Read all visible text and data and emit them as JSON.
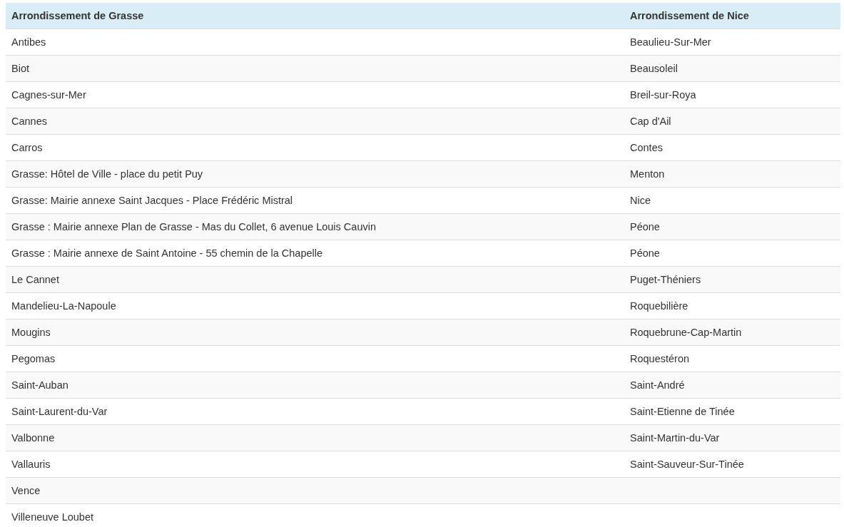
{
  "table": {
    "columns": [
      "Arrondissement de Grasse",
      "Arrondissement de Nice"
    ],
    "rows": [
      {
        "cells": [
          "Antibes",
          "Beaulieu-Sur-Mer"
        ]
      },
      {
        "cells": [
          "Biot",
          "Beausoleil"
        ]
      },
      {
        "cells": [
          "Cagnes-sur-Mer",
          "Breil-sur-Roya"
        ]
      },
      {
        "cells": [
          "Cannes",
          "Cap d'Ail"
        ]
      },
      {
        "cells": [
          "Carros",
          "Contes"
        ]
      },
      {
        "cells": [
          "Grasse: Hôtel de Ville - place du petit Puy",
          "Menton"
        ]
      },
      {
        "cells": [
          "Grasse: Mairie annexe Saint Jacques - Place Frédéric Mistral",
          "Nice"
        ]
      },
      {
        "cells": [
          "Grasse : Mairie annexe Plan de Grasse - Mas du Collet, 6 avenue Louis Cauvin",
          "Péone"
        ]
      },
      {
        "cells": [
          "Grasse : Mairie annexe de Saint Antoine - 55 chemin de la Chapelle",
          "Péone"
        ]
      },
      {
        "cells": [
          "Le Cannet",
          "Puget-Théniers"
        ]
      },
      {
        "cells": [
          "Mandelieu-La-Napoule",
          "Roquebilière"
        ]
      },
      {
        "cells": [
          "Mougins",
          "Roquebrune-Cap-Martin"
        ]
      },
      {
        "cells": [
          "Pegomas",
          "Roquestéron"
        ]
      },
      {
        "cells": [
          "Saint-Auban",
          "Saint-André"
        ]
      },
      {
        "cells": [
          "Saint-Laurent-du-Var",
          "Saint-Etienne de Tinée"
        ]
      },
      {
        "cells": [
          "Valbonne",
          "Saint-Martin-du-Var"
        ]
      },
      {
        "cells": [
          "Vallauris",
          "Saint-Sauveur-Sur-Tinée"
        ]
      },
      {
        "cells": [
          "Vence"
        ]
      },
      {
        "cells": [
          "Villeneuve Loubet"
        ]
      }
    ]
  }
}
